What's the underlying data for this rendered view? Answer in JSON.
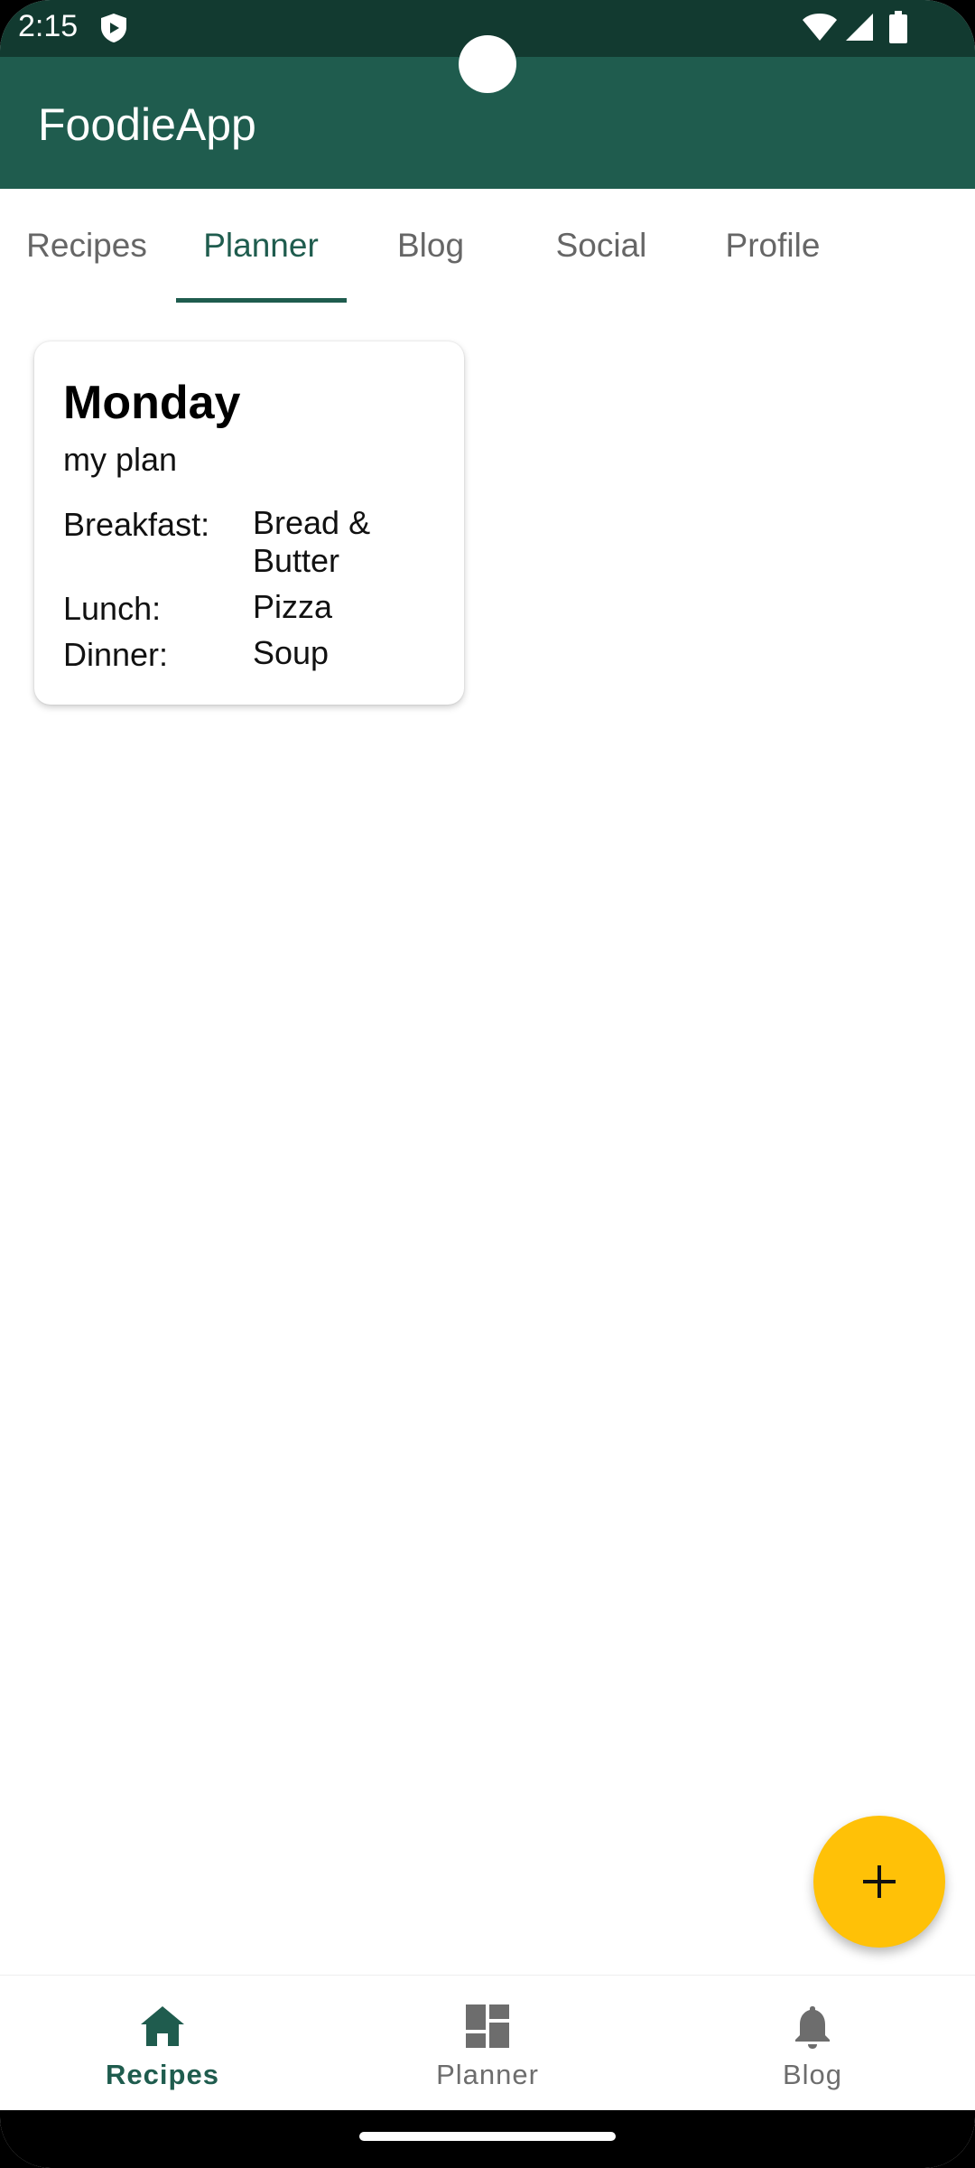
{
  "status_bar": {
    "time": "2:15"
  },
  "app_bar": {
    "title": "FoodieApp"
  },
  "tabs": [
    {
      "label": "Recipes",
      "active": false
    },
    {
      "label": "Planner",
      "active": true
    },
    {
      "label": "Blog",
      "active": false
    },
    {
      "label": "Social",
      "active": false
    },
    {
      "label": "Profile",
      "active": false
    }
  ],
  "plan_card": {
    "day": "Monday",
    "subtitle": "my plan",
    "meals": [
      {
        "label": "Breakfast:",
        "value": "Bread & Butter"
      },
      {
        "label": "Lunch:",
        "value": "Pizza"
      },
      {
        "label": "Dinner:",
        "value": "Soup"
      }
    ]
  },
  "fab": {
    "icon": "plus-icon"
  },
  "bottom_nav": [
    {
      "label": "Recipes",
      "icon": "home-icon",
      "active": true
    },
    {
      "label": "Planner",
      "icon": "dashboard-icon",
      "active": false
    },
    {
      "label": "Blog",
      "icon": "bell-icon",
      "active": false
    }
  ],
  "colors": {
    "primary": "#1f5c4e",
    "status_bar": "#123a30",
    "accent": "#ffc107"
  }
}
